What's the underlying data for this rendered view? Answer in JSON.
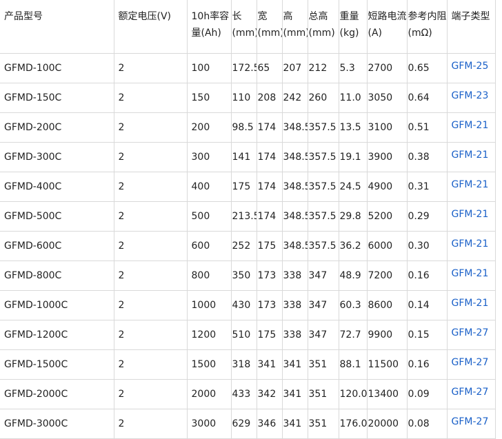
{
  "headers": [
    {
      "lines": [
        "产品型号"
      ]
    },
    {
      "lines": [
        "额定电压(V)"
      ]
    },
    {
      "lines": [
        "10h率容",
        "量(Ah)"
      ]
    },
    {
      "lines": [
        "长",
        "(mm)"
      ]
    },
    {
      "lines": [
        "宽",
        "(mm)"
      ]
    },
    {
      "lines": [
        "高",
        "(mm)"
      ]
    },
    {
      "lines": [
        "总高",
        "(mm)"
      ]
    },
    {
      "lines": [
        "重量",
        "(kg)"
      ]
    },
    {
      "lines": [
        "短路电流",
        "(A)"
      ]
    },
    {
      "lines": [
        "参考内阻",
        "(mΩ)"
      ]
    },
    {
      "lines": [
        "端子类型"
      ]
    }
  ],
  "rows": [
    [
      "GFMD-100C",
      "2",
      "100",
      "172.5",
      "65",
      "207",
      "212",
      "5.3",
      "2700",
      "0.65",
      "GFM-25"
    ],
    [
      "GFMD-150C",
      "2",
      "150",
      "110",
      "208",
      "242",
      "260",
      "11.0",
      "3050",
      "0.64",
      "GFM-23"
    ],
    [
      "GFMD-200C",
      "2",
      "200",
      "98.5",
      "174",
      "348.5",
      "357.5",
      "13.5",
      "3100",
      "0.51",
      "GFM-21"
    ],
    [
      "GFMD-300C",
      "2",
      "300",
      "141",
      "174",
      "348.5",
      "357.5",
      "19.1",
      "3900",
      "0.38",
      "GFM-21"
    ],
    [
      "GFMD-400C",
      "2",
      "400",
      "175",
      "174",
      "348.5",
      "357.5",
      "24.5",
      "4900",
      "0.31",
      "GFM-21"
    ],
    [
      "GFMD-500C",
      "2",
      "500",
      "213.5",
      "174",
      "348.5",
      "357.5",
      "29.8",
      "5200",
      "0.29",
      "GFM-21"
    ],
    [
      "GFMD-600C",
      "2",
      "600",
      "252",
      "175",
      "348.5",
      "357.5",
      "36.2",
      "6000",
      "0.30",
      "GFM-21"
    ],
    [
      "GFMD-800C",
      "2",
      "800",
      "350",
      "173",
      "338",
      "347",
      "48.9",
      "7200",
      "0.16",
      "GFM-21"
    ],
    [
      "GFMD-1000C",
      "2",
      "1000",
      "430",
      "173",
      "338",
      "347",
      "60.3",
      "8600",
      "0.14",
      "GFM-21"
    ],
    [
      "GFMD-1200C",
      "2",
      "1200",
      "510",
      "175",
      "338",
      "347",
      "72.7",
      "9900",
      "0.15",
      "GFM-27"
    ],
    [
      "GFMD-1500C",
      "2",
      "1500",
      "318",
      "341",
      "341",
      "351",
      "88.1",
      "11500",
      "0.16",
      "GFM-27"
    ],
    [
      "GFMD-2000C",
      "2",
      "2000",
      "433",
      "342",
      "341",
      "351",
      "120.0",
      "13400",
      "0.09",
      "GFM-27"
    ],
    [
      "GFMD-3000C",
      "2",
      "3000",
      "629",
      "346",
      "341",
      "351",
      "176.0",
      "20000",
      "0.08",
      "GFM-27"
    ]
  ]
}
